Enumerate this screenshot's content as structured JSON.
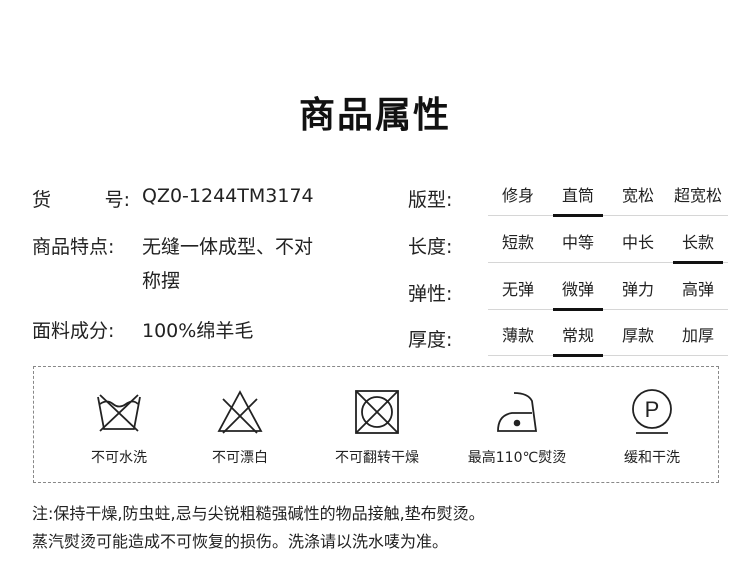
{
  "title": "商品属性",
  "info": {
    "item_no_label_left": "货",
    "item_no_label_right": "号:",
    "item_no": "QZ0-1244TM3174",
    "feature_label": "商品特点:",
    "feature_line1": "无缝一体成型、不对",
    "feature_line2": "称摆",
    "material_label": "面料成分:",
    "material": "100%绵羊毛"
  },
  "attributes": [
    {
      "label": "版型:",
      "options": [
        "修身",
        "直筒",
        "宽松",
        "超宽松"
      ],
      "selected": "直筒"
    },
    {
      "label": "长度:",
      "options": [
        "短款",
        "中等",
        "中长",
        "长款"
      ],
      "selected": "长款"
    },
    {
      "label": "弹性:",
      "options": [
        "无弹",
        "微弹",
        "弹力",
        "高弹"
      ],
      "selected": "微弹"
    },
    {
      "label": "厚度:",
      "options": [
        "薄款",
        "常规",
        "厚款",
        "加厚"
      ],
      "selected": "常规"
    }
  ],
  "care": [
    {
      "icon": "no-water-wash-icon",
      "label": "不可水洗"
    },
    {
      "icon": "no-bleach-icon",
      "label": "不可漂白"
    },
    {
      "icon": "no-tumble-dry-icon",
      "label": "不可翻转干燥"
    },
    {
      "icon": "iron-110-icon",
      "label": "最高110℃熨烫"
    },
    {
      "icon": "gentle-dry-clean-icon",
      "label": "缓和干洗"
    }
  ],
  "notes": {
    "line1": "注:保持干燥,防虫蛀,忌与尖锐粗糙强碱性的物品接触,垫布熨烫。",
    "line2": "蒸汽熨烫可能造成不可恢复的损伤。洗涤请以洗水唛为准。"
  }
}
